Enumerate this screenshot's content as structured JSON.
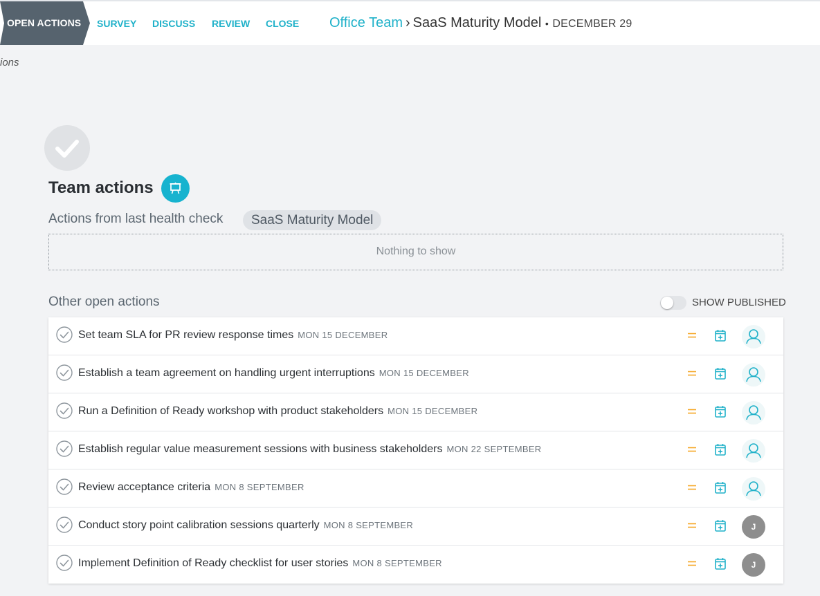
{
  "nav": {
    "active_step": "OPEN ACTIONS",
    "steps": [
      "SURVEY",
      "DISCUSS",
      "REVIEW",
      "CLOSE"
    ]
  },
  "breadcrumb": {
    "team": "Office Team",
    "separator": "›",
    "model": "SaaS Maturity Model",
    "bullet": "•",
    "date": "DECEMBER 29"
  },
  "partial_text": "ions",
  "header": {
    "title": "Team actions",
    "subtitle": "Actions from last health check",
    "model_pill": "SaaS Maturity Model",
    "empty_text": "Nothing to show"
  },
  "other": {
    "title": "Other open actions",
    "toggle_label": "SHOW PUBLISHED",
    "toggle_on": false
  },
  "actions": [
    {
      "text": "Set team SLA for PR review response times",
      "date": "MON 15 DECEMBER",
      "assignee": ""
    },
    {
      "text": "Establish a team agreement on handling urgent interruptions",
      "date": "MON 15 DECEMBER",
      "assignee": ""
    },
    {
      "text": "Run a Definition of Ready workshop with product stakeholders",
      "date": "MON 15 DECEMBER",
      "assignee": ""
    },
    {
      "text": "Establish regular value measurement sessions with business stakeholders",
      "date": "MON 22 SEPTEMBER",
      "assignee": ""
    },
    {
      "text": "Review acceptance criteria",
      "date": "MON 8 SEPTEMBER",
      "assignee": ""
    },
    {
      "text": "Conduct story point calibration sessions quarterly",
      "date": "MON 8 SEPTEMBER",
      "assignee": "J"
    },
    {
      "text": "Implement Definition of Ready checklist for user stories",
      "date": "MON 8 SEPTEMBER",
      "assignee": "J"
    }
  ],
  "icons": {
    "check": "check-icon",
    "present": "presentation-board-icon",
    "priority": "equals-priority-icon",
    "calendar": "calendar-add-icon",
    "user": "user-outline-icon"
  },
  "colors": {
    "accent": "#1fb1c9",
    "active_step_bg": "#56636e",
    "priority": "#f5a623"
  }
}
